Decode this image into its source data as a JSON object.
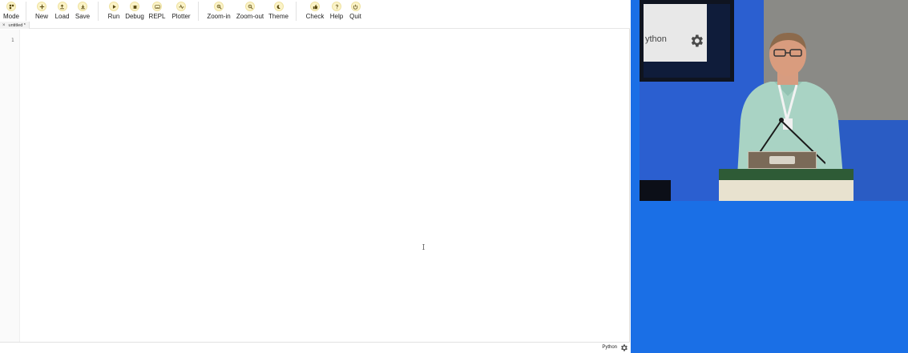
{
  "toolbar": {
    "groups": [
      [
        {
          "id": "mode",
          "label": "Mode",
          "icon": "mode-icon"
        }
      ],
      [
        {
          "id": "new",
          "label": "New",
          "icon": "plus-icon"
        },
        {
          "id": "load",
          "label": "Load",
          "icon": "upload-icon"
        },
        {
          "id": "save",
          "label": "Save",
          "icon": "download-icon"
        }
      ],
      [
        {
          "id": "run",
          "label": "Run",
          "icon": "play-icon"
        },
        {
          "id": "debug",
          "label": "Debug",
          "icon": "bug-icon"
        },
        {
          "id": "repl",
          "label": "REPL",
          "icon": "keyboard-icon"
        },
        {
          "id": "plotter",
          "label": "Plotter",
          "icon": "pulse-icon"
        }
      ],
      [
        {
          "id": "zoom-in",
          "label": "Zoom-in",
          "icon": "zoom-in-icon"
        },
        {
          "id": "zoom-out",
          "label": "Zoom-out",
          "icon": "zoom-out-icon"
        },
        {
          "id": "theme",
          "label": "Theme",
          "icon": "moon-icon"
        }
      ],
      [
        {
          "id": "check",
          "label": "Check",
          "icon": "thumbs-up-icon"
        },
        {
          "id": "help",
          "label": "Help",
          "icon": "question-icon"
        },
        {
          "id": "quit",
          "label": "Quit",
          "icon": "power-icon"
        }
      ]
    ]
  },
  "tabs": [
    {
      "label": "untitled *",
      "close": "×"
    }
  ],
  "editor": {
    "line_numbers": [
      "1"
    ]
  },
  "status": {
    "mode": "Python"
  },
  "video": {
    "screen_text": "ython"
  },
  "colors": {
    "icon_fill": "#fbf3c8",
    "video_background": "#1a6fe6"
  }
}
